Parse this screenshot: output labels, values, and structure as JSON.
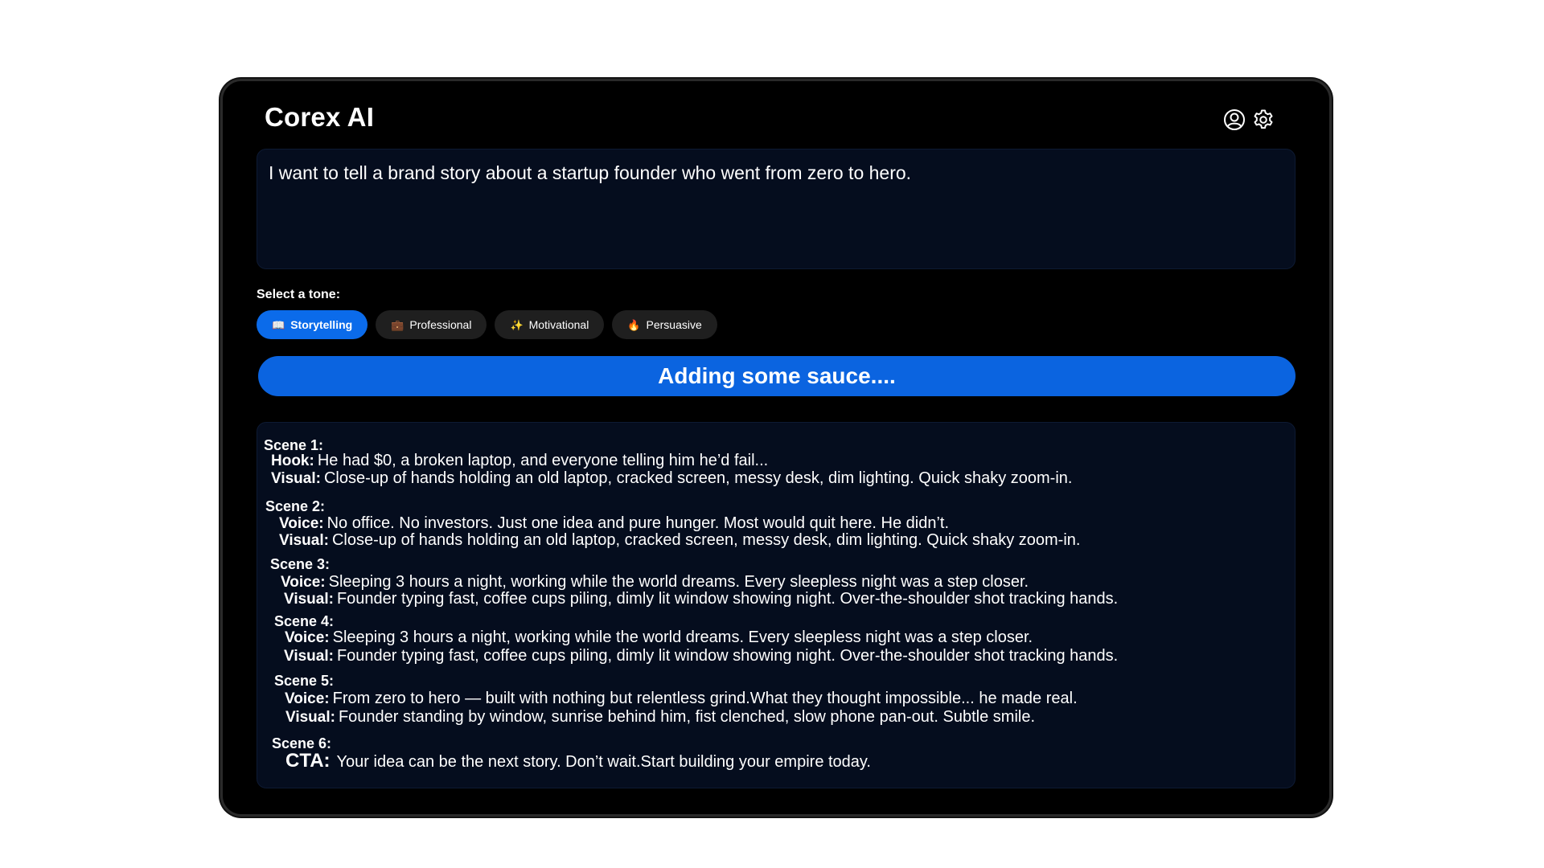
{
  "app": {
    "title": "Corex AI"
  },
  "header": {
    "icons": [
      "user-icon",
      "gear-icon"
    ]
  },
  "prompt": {
    "value": "I want to tell a brand story about a startup founder who went from zero to hero."
  },
  "tone": {
    "label": "Select a tone:",
    "options": [
      {
        "emoji": "📖",
        "label": "Storytelling",
        "active": true
      },
      {
        "emoji": "💼",
        "label": "Professional",
        "active": false
      },
      {
        "emoji": "✨",
        "label": "Motivational",
        "active": false
      },
      {
        "emoji": "🔥",
        "label": "Persuasive",
        "active": false
      }
    ]
  },
  "generate_button": {
    "label": "Adding some sauce...."
  },
  "output": {
    "scenes": [
      {
        "title": "Scene 1:",
        "lines": [
          {
            "key": "Hook:",
            "text": "He had $0, a broken laptop, and everyone telling him he’d fail..."
          },
          {
            "key": "Visual:",
            "text": "Close-up of hands holding an old laptop, cracked screen, messy desk, dim lighting. Quick shaky zoom-in."
          }
        ]
      },
      {
        "title": "Scene 2:",
        "lines": [
          {
            "key": "Voice:",
            "text": "No office. No investors. Just one idea and pure hunger. Most would quit here. He didn’t."
          },
          {
            "key": "Visual:",
            "text": "Close-up of hands holding an old laptop, cracked screen, messy desk, dim lighting. Quick shaky zoom-in."
          }
        ]
      },
      {
        "title": "Scene 3:",
        "lines": [
          {
            "key": "Voice:",
            "text": "Sleeping 3 hours a night, working while the world dreams. Every sleepless night was a step closer."
          },
          {
            "key": "Visual:",
            "text": "Founder typing fast, coffee cups piling, dimly lit window showing night. Over-the-shoulder shot tracking hands."
          }
        ]
      },
      {
        "title": "Scene 4:",
        "lines": [
          {
            "key": "Voice:",
            "text": "Sleeping 3 hours a night, working while the world dreams. Every sleepless night was a step closer."
          },
          {
            "key": "Visual:",
            "text": "Founder typing fast, coffee cups piling, dimly lit window showing night. Over-the-shoulder shot tracking hands."
          }
        ]
      },
      {
        "title": "Scene 5:",
        "lines": [
          {
            "key": "Voice:",
            "text": "From zero to hero — built with nothing but relentless grind.What they thought impossible... he made real."
          },
          {
            "key": "Visual:",
            "text": "Founder standing by window, sunrise behind him, fist clenched, slow phone pan-out. Subtle smile."
          }
        ]
      },
      {
        "title": "Scene 6:",
        "lines": [
          {
            "key": "CTA:",
            "text": "Your idea can be the next story. Don’t wait.Start building your empire today."
          }
        ]
      }
    ]
  },
  "colors": {
    "accent": "#0b64e0",
    "panel": "#050d1e",
    "chip": "#1f1f1f",
    "device": "#000000"
  }
}
